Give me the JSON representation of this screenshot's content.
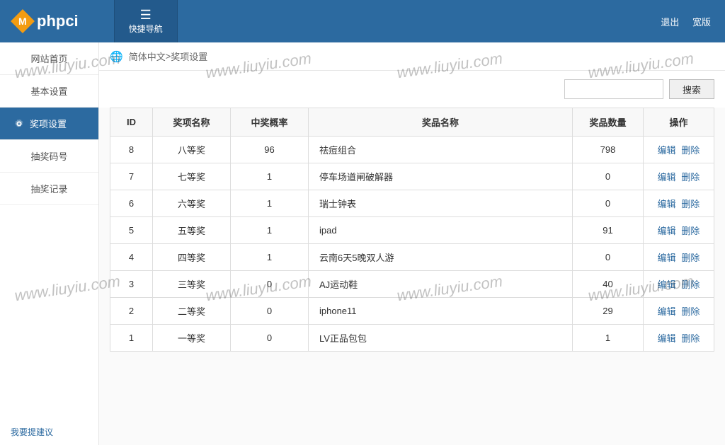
{
  "header": {
    "logo_text": "phpci",
    "logo_badge": "M",
    "quick_nav": "快捷导航",
    "logout": "退出",
    "wide": "宽版"
  },
  "sidebar": {
    "items": [
      {
        "label": "网站首页"
      },
      {
        "label": "基本设置"
      },
      {
        "label": "奖项设置"
      },
      {
        "label": "抽奖码号"
      },
      {
        "label": "抽奖记录"
      }
    ],
    "footer_link": "我要提建议"
  },
  "breadcrumb": {
    "lang": "简体中文",
    "sep": " > ",
    "page": "奖项设置"
  },
  "search": {
    "button": "搜索",
    "placeholder": ""
  },
  "table": {
    "headers": {
      "id": "ID",
      "award_name": "奖项名称",
      "probability": "中奖概率",
      "prize_name": "奖品名称",
      "quantity": "奖品数量",
      "ops": "操作"
    },
    "actions": {
      "edit": "编辑",
      "delete": "删除"
    },
    "rows": [
      {
        "id": "8",
        "award_name": "八等奖",
        "probability": "96",
        "prize_name": "祛痘组合",
        "quantity": "798"
      },
      {
        "id": "7",
        "award_name": "七等奖",
        "probability": "1",
        "prize_name": "停车场道闸破解器",
        "quantity": "0"
      },
      {
        "id": "6",
        "award_name": "六等奖",
        "probability": "1",
        "prize_name": "瑞士钟表",
        "quantity": "0"
      },
      {
        "id": "5",
        "award_name": "五等奖",
        "probability": "1",
        "prize_name": "ipad",
        "quantity": "91"
      },
      {
        "id": "4",
        "award_name": "四等奖",
        "probability": "1",
        "prize_name": "云南6天5晚双人游",
        "quantity": "0"
      },
      {
        "id": "3",
        "award_name": "三等奖",
        "probability": "0",
        "prize_name": "AJ运动鞋",
        "quantity": "40"
      },
      {
        "id": "2",
        "award_name": "二等奖",
        "probability": "0",
        "prize_name": "iphone11",
        "quantity": "29"
      },
      {
        "id": "1",
        "award_name": "一等奖",
        "probability": "0",
        "prize_name": "LV正品包包",
        "quantity": "1"
      }
    ]
  },
  "watermark_text": "www.liuyiu.com"
}
